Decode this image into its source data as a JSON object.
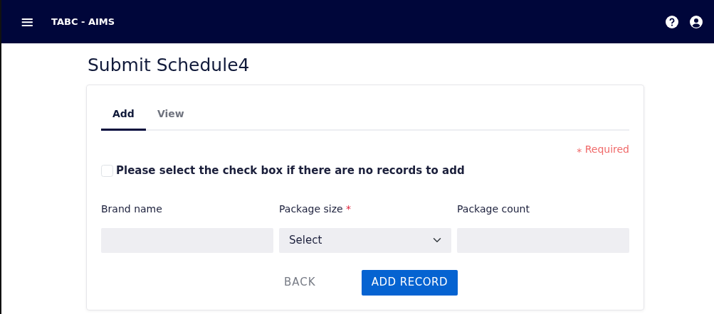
{
  "navbar": {
    "menu_icon": "≡",
    "title": "TABC - AIMS"
  },
  "page_title": "Submit Schedule4",
  "tabs": [
    {
      "label": "Add",
      "selected": true
    },
    {
      "label": "View",
      "selected": false
    }
  ],
  "required_note": {
    "mark": "⁎",
    "text": "Required"
  },
  "no_records": {
    "label": "Please select the check box if there are no records to add",
    "checked": false
  },
  "fields": [
    {
      "kind": "input",
      "label": "Brand name"
    },
    {
      "kind": "select",
      "label": "Package size",
      "required_mark": "*",
      "value": "Select"
    },
    {
      "kind": "input",
      "label": "Package count"
    }
  ],
  "buttons": [
    {
      "kind": "text",
      "label": "BACK"
    },
    {
      "kind": "primary",
      "label": "ADD RECORD"
    }
  ]
}
